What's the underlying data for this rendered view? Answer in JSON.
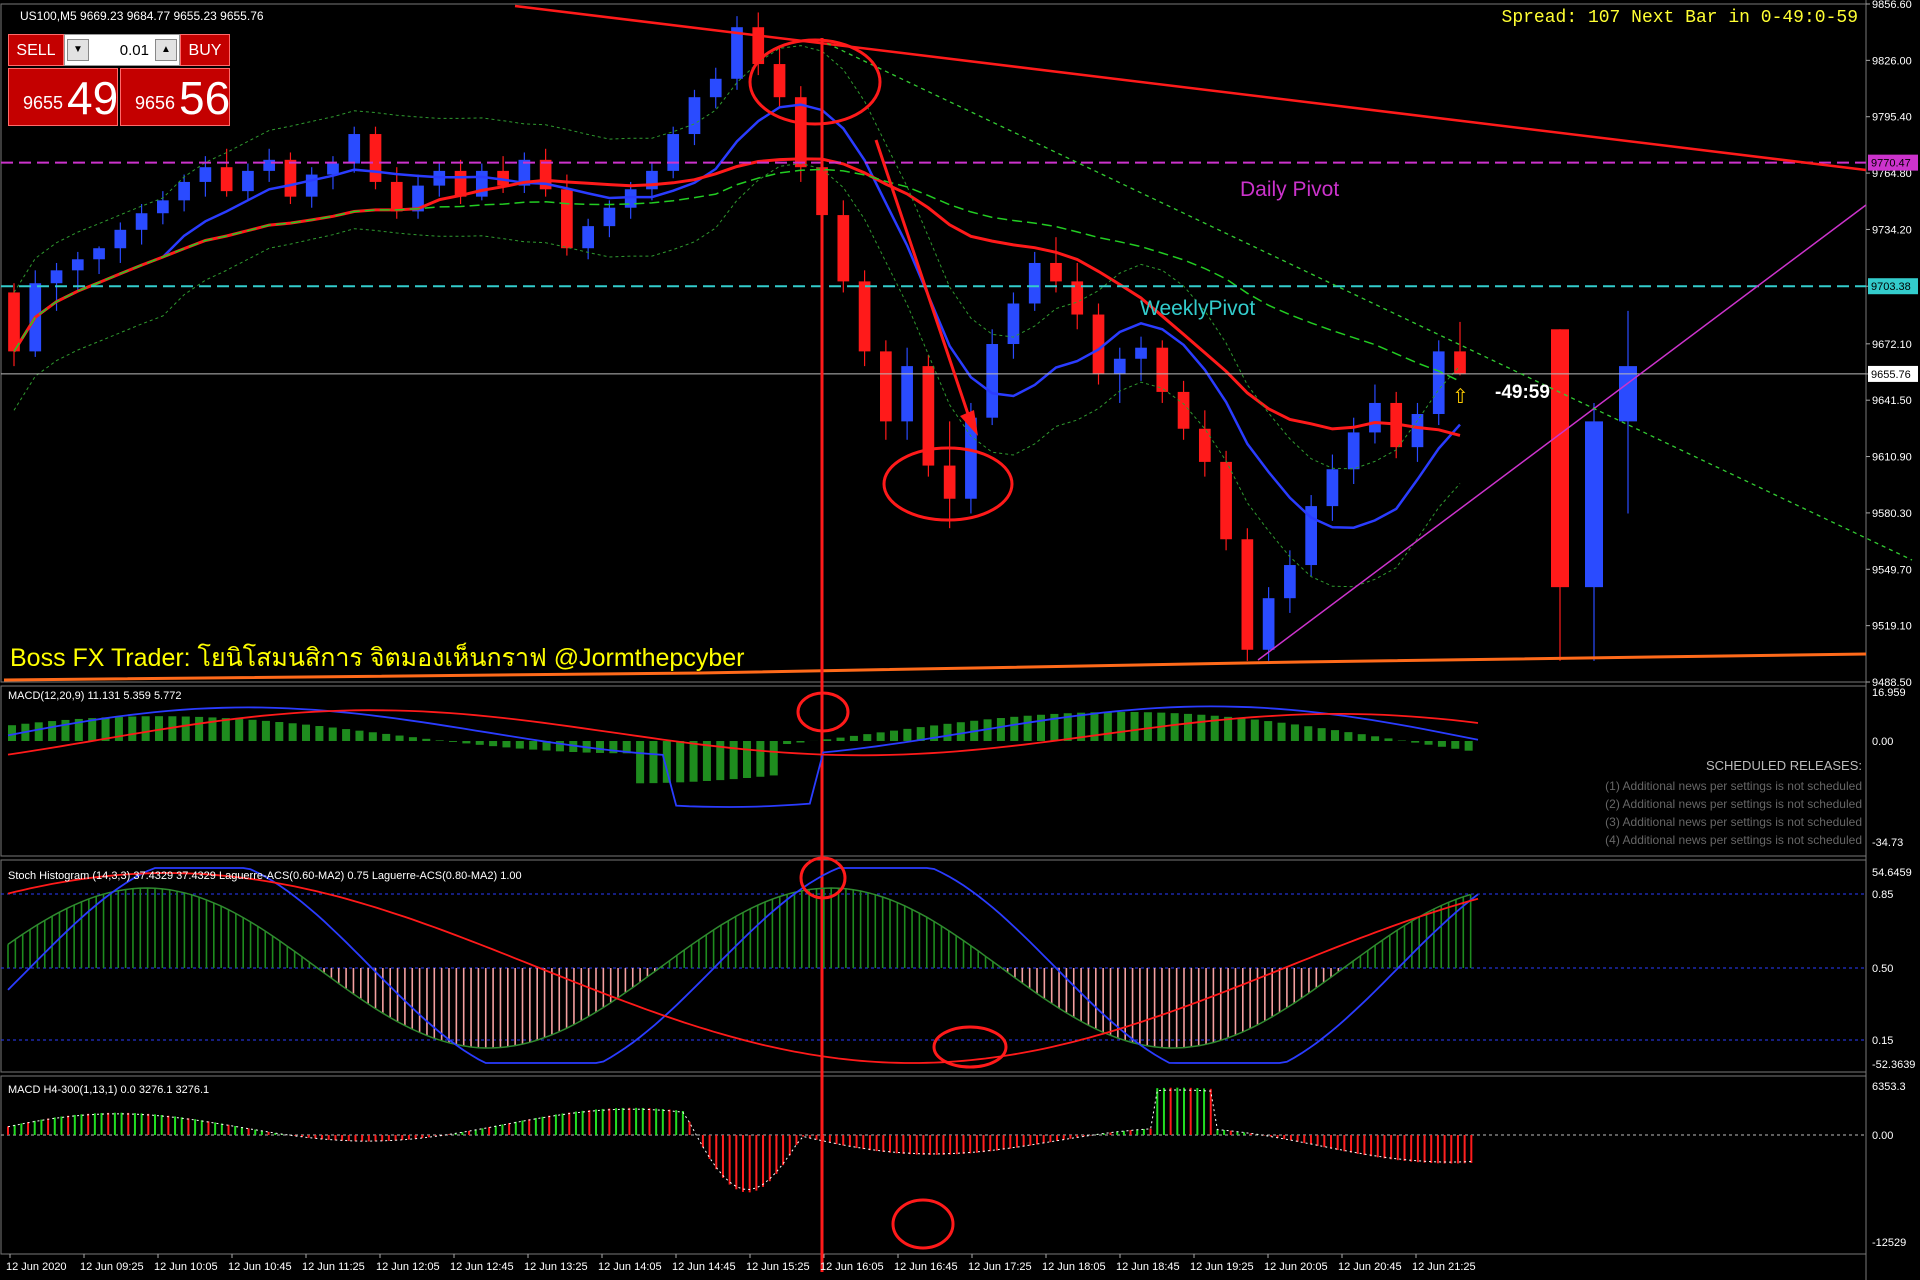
{
  "window": {
    "symbol_info": "US100,M5  9669.23 9684.77 9655.23 9655.76",
    "spread_info": "Spread: 107 Next Bar in 0-49:0-59"
  },
  "trade_panel": {
    "sell_label": "SELL",
    "buy_label": "BUY",
    "lot_value": "0.01",
    "sell_price_prefix": "9655",
    "sell_price_big": "49",
    "buy_price_prefix": "9656",
    "buy_price_big": "56",
    "accent_color": "#c40000"
  },
  "main_chart": {
    "price_ticks": [
      "9856.60",
      "9826.00",
      "9795.40",
      "9764.80",
      "9734.20",
      "9703.38",
      "9672.10",
      "9655.76",
      "9641.50",
      "9610.90",
      "9580.30",
      "9549.70",
      "9519.10",
      "9488.50"
    ],
    "daily_pivot_badge": "9770.47",
    "weekly_pivot_badge": "9703.38",
    "current_price_badge": "9655.76",
    "daily_pivot_label": "Daily Pivot",
    "weekly_pivot_label": "WeeklyPivot",
    "countdown_label": "-49:59",
    "arrow_symbol": "⇧",
    "watermark": "Boss FX Trader: โยนิโสมนสิการ จิตมองเห็นกราฟ @Jormthepcyber"
  },
  "macd_panel": {
    "title": "MACD(12,20,9) 11.131 5.359 5.772",
    "ticks": [
      "16.959",
      "0.00",
      "-34.73"
    ],
    "scheduled_title": "SCHEDULED RELEASES:",
    "scheduled_lines": [
      "(1)  Additional news per settings is not scheduled",
      "(2)  Additional news per settings is not scheduled",
      "(3)  Additional news per settings is not scheduled",
      "(4)  Additional news per settings is not scheduled"
    ]
  },
  "stoch_panel": {
    "title": "Stoch Histogram (14,3,3) 37.4329 37.4329  Laguerre-ACS(0.60-MA2) 0.75  Laguerre-ACS(0.80-MA2) 1.00",
    "ticks": [
      "54.6459",
      "0.85",
      "0.50",
      "0.15",
      "-52.3639"
    ]
  },
  "h4_panel": {
    "title": "MACD H4-300(1,13,1) 0.0 3276.1 3276.1",
    "ticks": [
      "6353.3",
      "0.00",
      "-12529"
    ]
  },
  "time_axis": [
    "12 Jun 2020",
    "12 Jun 09:25",
    "12 Jun 10:05",
    "12 Jun 10:45",
    "12 Jun 11:25",
    "12 Jun 12:05",
    "12 Jun 12:45",
    "12 Jun 13:25",
    "12 Jun 14:05",
    "12 Jun 14:45",
    "12 Jun 15:25",
    "12 Jun 16:05",
    "12 Jun 16:45",
    "12 Jun 17:25",
    "12 Jun 18:05",
    "12 Jun 18:45",
    "12 Jun 19:25",
    "12 Jun 20:05",
    "12 Jun 20:45",
    "12 Jun 21:25"
  ],
  "colors": {
    "bull": "#2a4bff",
    "bear": "#ff1a1a",
    "daily_pivot": "#cc33cc",
    "weekly_pivot": "#33cccc",
    "trend": "#ff1a1a",
    "macd_hist": "#1e8c1e",
    "stoch_pos": "#1e8c1e",
    "stoch_neg": "#f5a0a0"
  },
  "chart_data": {
    "type": "candlestick",
    "symbol": "US100",
    "timeframe": "M5",
    "ylim": [
      9488.5,
      9856.6
    ],
    "ohlc": [
      [
        9700,
        9705,
        9660,
        9668
      ],
      [
        9668,
        9712,
        9665,
        9705
      ],
      [
        9705,
        9716,
        9690,
        9712
      ],
      [
        9712,
        9722,
        9700,
        9718
      ],
      [
        9718,
        9725,
        9710,
        9724
      ],
      [
        9724,
        9738,
        9716,
        9734
      ],
      [
        9734,
        9748,
        9726,
        9743
      ],
      [
        9743,
        9755,
        9737,
        9750
      ],
      [
        9750,
        9764,
        9744,
        9760
      ],
      [
        9760,
        9774,
        9752,
        9768
      ],
      [
        9768,
        9778,
        9752,
        9755
      ],
      [
        9755,
        9770,
        9750,
        9766
      ],
      [
        9766,
        9778,
        9760,
        9772
      ],
      [
        9772,
        9776,
        9748,
        9752
      ],
      [
        9752,
        9768,
        9746,
        9764
      ],
      [
        9764,
        9774,
        9756,
        9770
      ],
      [
        9770,
        9790,
        9765,
        9786
      ],
      [
        9786,
        9790,
        9756,
        9760
      ],
      [
        9760,
        9768,
        9740,
        9744
      ],
      [
        9744,
        9764,
        9740,
        9758
      ],
      [
        9758,
        9770,
        9752,
        9766
      ],
      [
        9766,
        9772,
        9748,
        9752
      ],
      [
        9752,
        9770,
        9750,
        9766
      ],
      [
        9766,
        9774,
        9754,
        9758
      ],
      [
        9758,
        9776,
        9754,
        9772
      ],
      [
        9772,
        9778,
        9752,
        9756
      ],
      [
        9756,
        9764,
        9720,
        9724
      ],
      [
        9724,
        9740,
        9718,
        9736
      ],
      [
        9736,
        9750,
        9730,
        9746
      ],
      [
        9746,
        9760,
        9740,
        9756
      ],
      [
        9756,
        9770,
        9750,
        9766
      ],
      [
        9766,
        9790,
        9762,
        9786
      ],
      [
        9786,
        9810,
        9780,
        9806
      ],
      [
        9806,
        9822,
        9800,
        9816
      ],
      [
        9816,
        9850,
        9810,
        9844
      ],
      [
        9844,
        9852,
        9818,
        9824
      ],
      [
        9824,
        9834,
        9800,
        9806
      ],
      [
        9806,
        9812,
        9760,
        9768
      ],
      [
        9768,
        9780,
        9736,
        9742
      ],
      [
        9742,
        9750,
        9700,
        9706
      ],
      [
        9706,
        9712,
        9660,
        9668
      ],
      [
        9668,
        9674,
        9620,
        9630
      ],
      [
        9630,
        9670,
        9620,
        9660
      ],
      [
        9660,
        9666,
        9600,
        9606
      ],
      [
        9606,
        9630,
        9572,
        9588
      ],
      [
        9588,
        9640,
        9580,
        9632
      ],
      [
        9632,
        9680,
        9628,
        9672
      ],
      [
        9672,
        9700,
        9664,
        9694
      ],
      [
        9694,
        9722,
        9690,
        9716
      ],
      [
        9716,
        9730,
        9700,
        9706
      ],
      [
        9706,
        9716,
        9680,
        9688
      ],
      [
        9688,
        9694,
        9650,
        9656
      ],
      [
        9656,
        9670,
        9640,
        9664
      ],
      [
        9664,
        9676,
        9652,
        9670
      ],
      [
        9670,
        9674,
        9640,
        9646
      ],
      [
        9646,
        9652,
        9620,
        9626
      ],
      [
        9626,
        9636,
        9600,
        9608
      ],
      [
        9608,
        9614,
        9560,
        9566
      ],
      [
        9566,
        9572,
        9500,
        9506
      ],
      [
        9506,
        9540,
        9500,
        9534
      ],
      [
        9534,
        9560,
        9526,
        9552
      ],
      [
        9552,
        9590,
        9546,
        9584
      ],
      [
        9584,
        9612,
        9576,
        9604
      ],
      [
        9604,
        9632,
        9596,
        9624
      ],
      [
        9624,
        9650,
        9618,
        9640
      ],
      [
        9640,
        9646,
        9610,
        9616
      ],
      [
        9616,
        9640,
        9608,
        9634
      ],
      [
        9634,
        9674,
        9628,
        9668
      ],
      [
        9668,
        9684,
        9655,
        9656
      ],
      [
        9680,
        9680,
        9500,
        9540
      ],
      [
        9540,
        9640,
        9500,
        9630
      ],
      [
        9630,
        9690,
        9580,
        9660
      ]
    ],
    "daily_pivot": 9770.47,
    "weekly_pivot": 9703.38,
    "current_price": 9655.76
  }
}
